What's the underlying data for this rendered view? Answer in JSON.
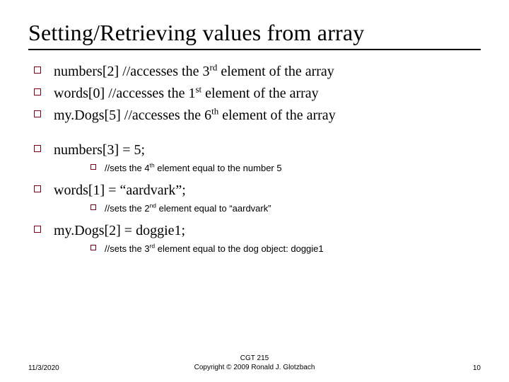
{
  "title": "Setting/Retrieving values from array",
  "lines": {
    "l1_a": "numbers[2]   //accesses the 3",
    "l1_sup": "rd",
    "l1_b": " element of the array",
    "l2_a": "words[0]       //accesses the 1",
    "l2_sup": "st",
    "l2_b": " element of the array",
    "l3_a": "my.Dogs[5]     //accesses the 6",
    "l3_sup": "th",
    "l3_b": " element of the array",
    "l4": "numbers[3] = 5;",
    "l4s_a": "//sets the 4",
    "l4s_sup": "th",
    "l4s_b": " element equal to the number 5",
    "l5": "words[1] = “aardvark”;",
    "l5s_a": "//sets the 2",
    "l5s_sup": "nd",
    "l5s_b": " element equal to “aardvark”",
    "l6": "my.Dogs[2] = doggie1;",
    "l6s_a": "//sets the 3",
    "l6s_sup": "rd",
    "l6s_b": " element equal to the dog object: doggie1"
  },
  "footer": {
    "date": "11/3/2020",
    "center1": "CGT 215",
    "center2": "Copyright © 2009 Ronald J. Glotzbach",
    "num": "10"
  }
}
